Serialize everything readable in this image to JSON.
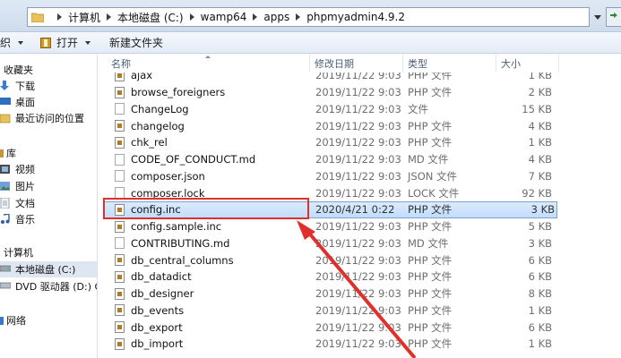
{
  "address": {
    "crumbs": [
      "计算机",
      "本地磁盘 (C:)",
      "wamp64",
      "apps",
      "phpmyadmin4.9.2"
    ]
  },
  "toolbar": {
    "organize_partial": "织",
    "open_label": "打开",
    "new_folder_label": "新建文件夹"
  },
  "nav": {
    "favorites": "收藏夹",
    "downloads": "下载",
    "desktop": "桌面",
    "recent": "最近访问的位置",
    "libraries": "库",
    "videos": "视频",
    "pictures": "图片",
    "documents": "文档",
    "music": "音乐",
    "computer": "计算机",
    "local_disk": "本地磁盘 (C:)",
    "dvd": "DVD 驱动器 (D:) GSI",
    "network": "网络"
  },
  "columns": {
    "name": "名称",
    "date": "修改日期",
    "type": "类型",
    "size": "大小"
  },
  "files": [
    {
      "name": "ajax",
      "date": "2019/11/22 9:03",
      "type": "PHP 文件",
      "size": "1 KB",
      "icon": "php-file-icon"
    },
    {
      "name": "browse_foreigners",
      "date": "2019/11/22 9:03",
      "type": "PHP 文件",
      "size": "2 KB",
      "icon": "php-file-icon"
    },
    {
      "name": "ChangeLog",
      "date": "2019/11/22 9:03",
      "type": "文件",
      "size": "15 KB",
      "icon": "blank-file-icon"
    },
    {
      "name": "changelog",
      "date": "2019/11/22 9:03",
      "type": "PHP 文件",
      "size": "4 KB",
      "icon": "php-file-icon"
    },
    {
      "name": "chk_rel",
      "date": "2019/11/22 9:03",
      "type": "PHP 文件",
      "size": "1 KB",
      "icon": "php-file-icon"
    },
    {
      "name": "CODE_OF_CONDUCT.md",
      "date": "2019/11/22 9:03",
      "type": "MD 文件",
      "size": "4 KB",
      "icon": "blank-file-icon"
    },
    {
      "name": "composer.json",
      "date": "2019/11/22 9:03",
      "type": "JSON 文件",
      "size": "7 KB",
      "icon": "blank-file-icon"
    },
    {
      "name": "composer.lock",
      "date": "2019/11/22 9:03",
      "type": "LOCK 文件",
      "size": "92 KB",
      "icon": "blank-file-icon"
    },
    {
      "name": "config.inc",
      "date": "2020/4/21 0:22",
      "type": "PHP 文件",
      "size": "3 KB",
      "icon": "php-file-icon",
      "selected": true
    },
    {
      "name": "config.sample.inc",
      "date": "2019/11/22 9:03",
      "type": "PHP 文件",
      "size": "5 KB",
      "icon": "php-file-icon"
    },
    {
      "name": "CONTRIBUTING.md",
      "date": "2019/11/22 9:03",
      "type": "MD 文件",
      "size": "3 KB",
      "icon": "blank-file-icon"
    },
    {
      "name": "db_central_columns",
      "date": "2019/11/22 9:03",
      "type": "PHP 文件",
      "size": "6 KB",
      "icon": "php-file-icon"
    },
    {
      "name": "db_datadict",
      "date": "2019/11/22 9:03",
      "type": "PHP 文件",
      "size": "6 KB",
      "icon": "php-file-icon"
    },
    {
      "name": "db_designer",
      "date": "2019/11/22 9:03",
      "type": "PHP 文件",
      "size": "8 KB",
      "icon": "php-file-icon"
    },
    {
      "name": "db_events",
      "date": "2019/11/22 9:03",
      "type": "PHP 文件",
      "size": "1 KB",
      "icon": "php-file-icon"
    },
    {
      "name": "db_export",
      "date": "2019/11/22 9:03",
      "type": "PHP 文件",
      "size": "6 KB",
      "icon": "php-file-icon"
    },
    {
      "name": "db_import",
      "date": "2019/11/22 9:03",
      "type": "PHP 文件",
      "size": "1 KB",
      "icon": "php-file-icon"
    }
  ],
  "colors": {
    "annotation_red": "#e0302c",
    "selection_bg": "#c1dcfc"
  }
}
